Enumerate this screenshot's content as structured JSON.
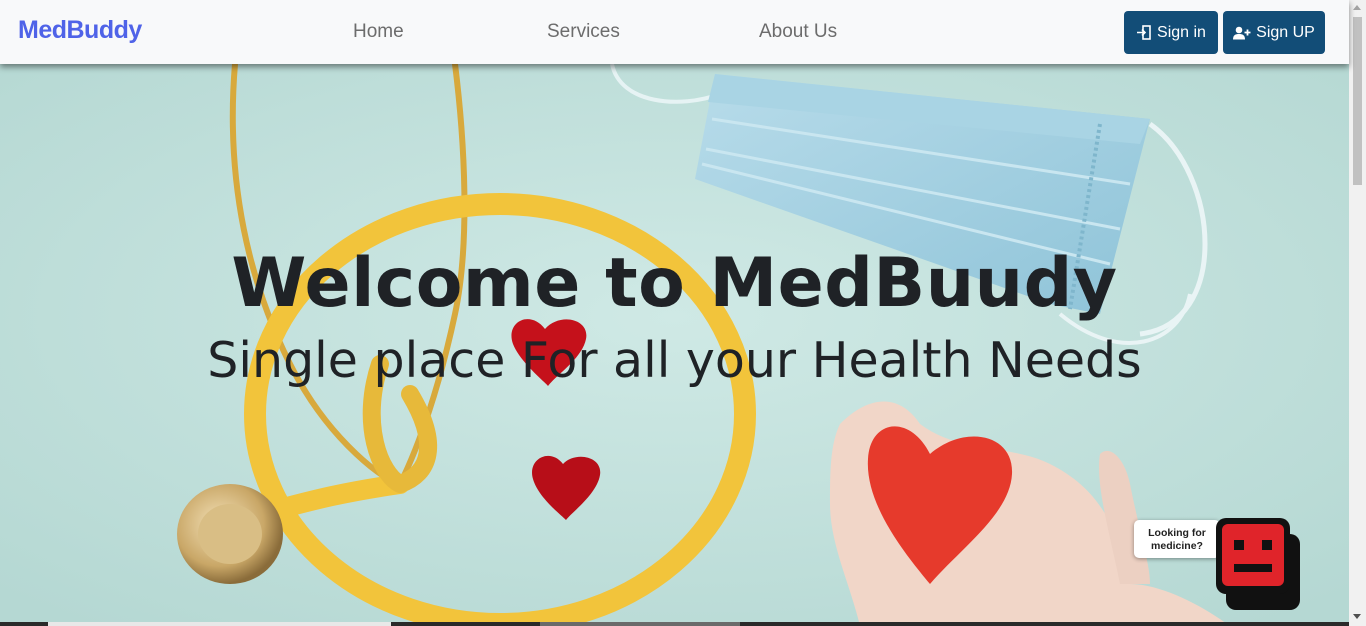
{
  "navbar": {
    "brand": "MedBuddy",
    "links": [
      "Home",
      "Services",
      "About Us"
    ],
    "sign_in_label": "Sign in",
    "sign_up_label": "Sign UP"
  },
  "hero": {
    "title": "Welcome to MedBuudy",
    "subtitle": "Single place For all your Health Needs"
  },
  "chat_widget": {
    "bubble_line1": "Looking for",
    "bubble_line2": "medicine?"
  },
  "colors": {
    "brand": "#4f63e8",
    "button_bg": "#124d77",
    "bot_red": "#e0242a"
  }
}
